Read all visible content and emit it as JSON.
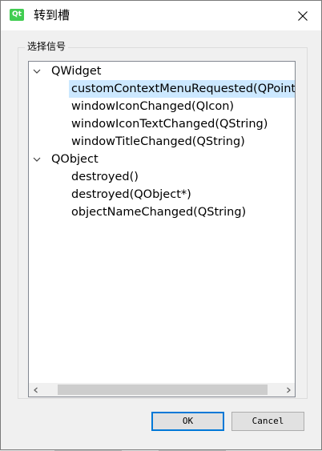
{
  "window": {
    "title": "转到槽",
    "icon_text": "Qt"
  },
  "group": {
    "label": "选择信号"
  },
  "tree": {
    "items": [
      {
        "label": "QWidget",
        "expanded": true,
        "children": [
          {
            "label": "customContextMenuRequested(QPoint)",
            "selected": true
          },
          {
            "label": "windowIconChanged(QIcon)"
          },
          {
            "label": "windowIconTextChanged(QString)"
          },
          {
            "label": "windowTitleChanged(QString)"
          }
        ]
      },
      {
        "label": "QObject",
        "expanded": true,
        "children": [
          {
            "label": "destroyed()"
          },
          {
            "label": "destroyed(QObject*)"
          },
          {
            "label": "objectNameChanged(QString)"
          }
        ]
      }
    ]
  },
  "buttons": {
    "ok": "OK",
    "cancel": "Cancel"
  },
  "colors": {
    "selection": "#cce8ff",
    "default_button_border": "#0078d7"
  }
}
